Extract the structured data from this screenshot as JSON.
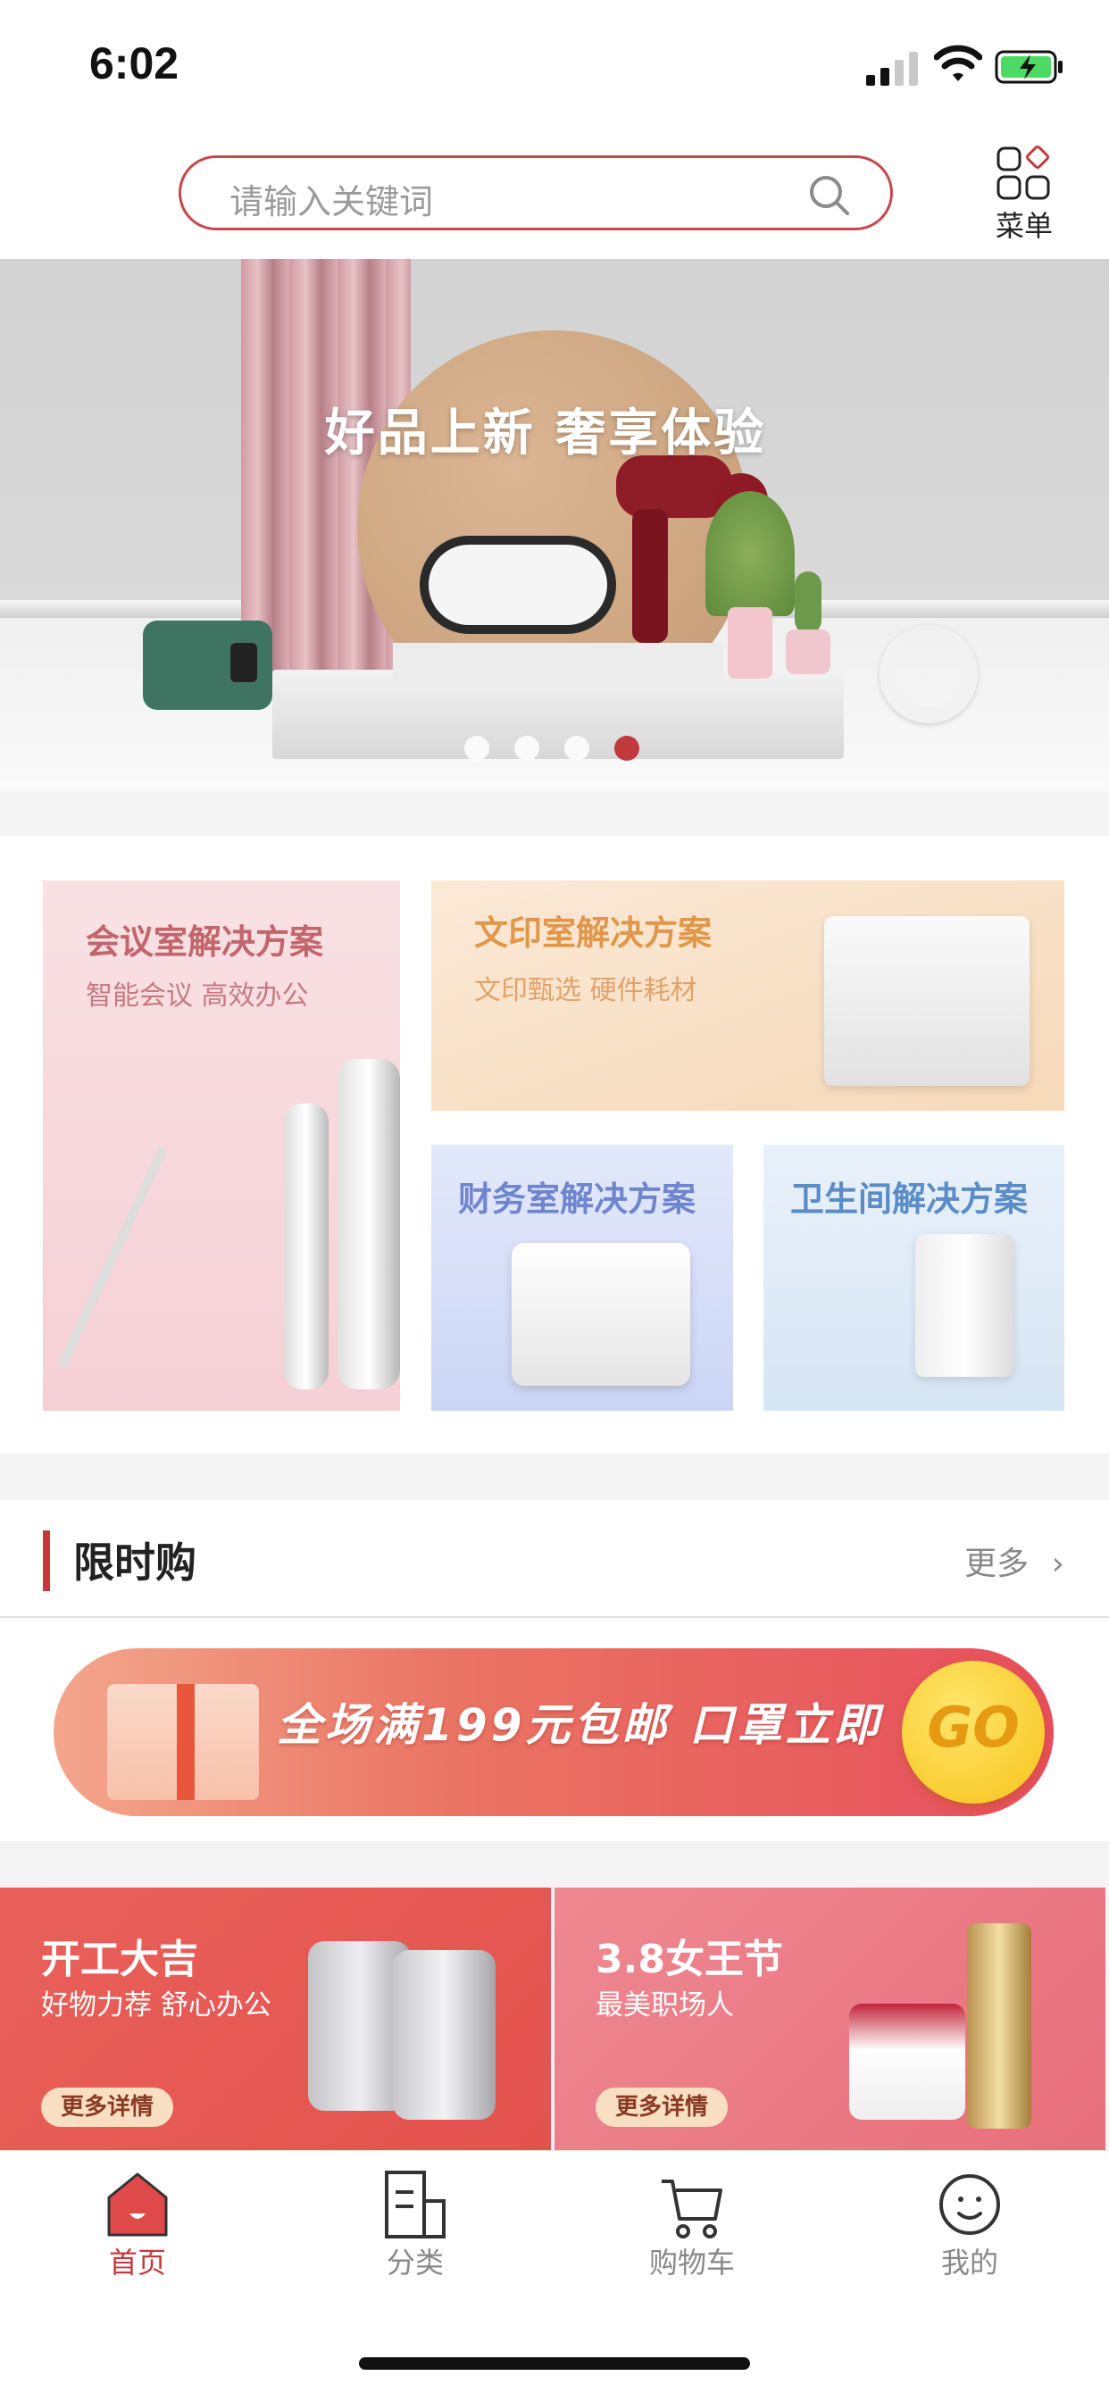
{
  "status_bar": {
    "time": "6:02"
  },
  "search": {
    "placeholder": "请输入关键词",
    "menu_label": "菜单"
  },
  "banner": {
    "title": "好品上新 奢享体验",
    "page_count": 4,
    "active_page": 4
  },
  "solutions": [
    {
      "title": "会议室解决方案",
      "subtitle": "智能会议 高效办公"
    },
    {
      "title": "文印室解决方案",
      "subtitle": "文印甄选 硬件耗材"
    },
    {
      "title": "财务室解决方案",
      "subtitle": ""
    },
    {
      "title": "卫生间解决方案",
      "subtitle": ""
    }
  ],
  "flash_sale": {
    "title": "限时购",
    "more": "更多"
  },
  "promo": {
    "text": "全场满199元包邮 口罩立即",
    "go": "GO"
  },
  "campaigns": [
    {
      "title": "开工大吉",
      "subtitle": "好物力荐 舒心办公",
      "button": "更多详情"
    },
    {
      "title": "3.8女王节",
      "subtitle": "最美职场人",
      "button": "更多详情"
    }
  ],
  "tabs": [
    {
      "label": "首页",
      "icon": "home-icon",
      "active": true
    },
    {
      "label": "分类",
      "icon": "category-icon",
      "active": false
    },
    {
      "label": "购物车",
      "icon": "cart-icon",
      "active": false
    },
    {
      "label": "我的",
      "icon": "profile-icon",
      "active": false
    }
  ],
  "colors": {
    "accent": "#c7383c",
    "promo_gradient_end": "#e74f5c"
  }
}
